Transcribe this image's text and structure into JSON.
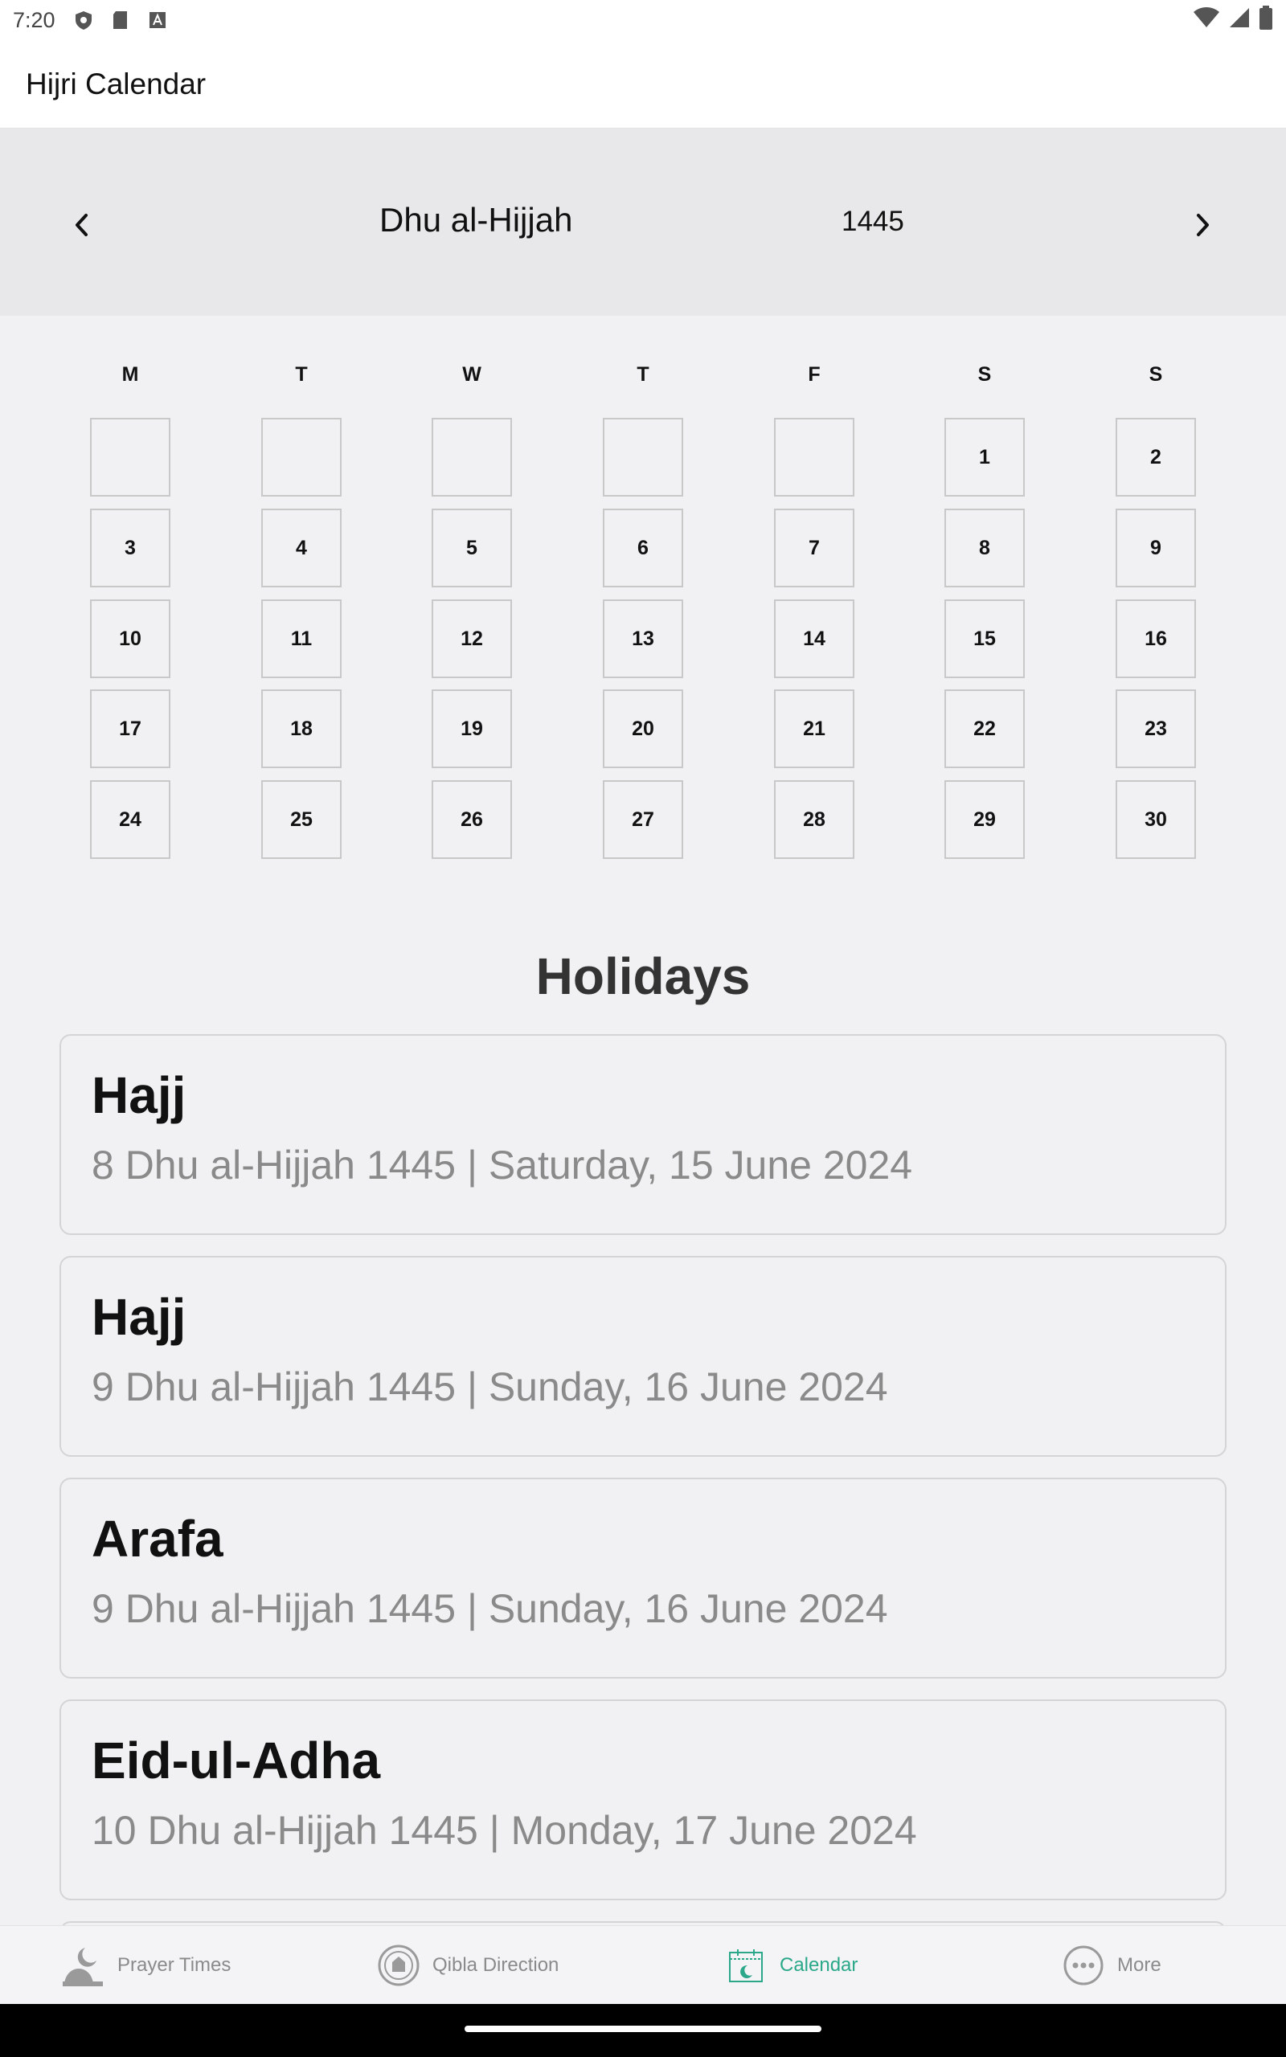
{
  "status_bar": {
    "time": "7:20"
  },
  "app_bar": {
    "title": "Hijri Calendar"
  },
  "month_nav": {
    "month": "Dhu al-Hijjah",
    "year": "1445"
  },
  "weekdays": [
    "M",
    "T",
    "W",
    "T",
    "F",
    "S",
    "S"
  ],
  "calendar": {
    "leading_blank_days": 5,
    "days": [
      "1",
      "2",
      "3",
      "4",
      "5",
      "6",
      "7",
      "8",
      "9",
      "10",
      "11",
      "12",
      "13",
      "14",
      "15",
      "16",
      "17",
      "18",
      "19",
      "20",
      "21",
      "22",
      "23",
      "24",
      "25",
      "26",
      "27",
      "28",
      "29",
      "30"
    ]
  },
  "holidays": {
    "title": "Holidays",
    "items": [
      {
        "name": "Hajj",
        "date": "8 Dhu al-Hijjah 1445 | Saturday, 15 June 2024"
      },
      {
        "name": "Hajj",
        "date": "9 Dhu al-Hijjah 1445 | Sunday, 16 June 2024"
      },
      {
        "name": "Arafa",
        "date": "9 Dhu al-Hijjah 1445 | Sunday, 16 June 2024"
      },
      {
        "name": "Eid-ul-Adha",
        "date": "10 Dhu al-Hijjah 1445 | Monday, 17 June 2024"
      }
    ]
  },
  "bottom_nav": {
    "items": [
      {
        "label": "Prayer Times",
        "icon": "mosque-moon-icon",
        "active": false
      },
      {
        "label": "Qibla Direction",
        "icon": "compass-icon",
        "active": false
      },
      {
        "label": "Calendar",
        "icon": "calendar-icon",
        "active": true
      },
      {
        "label": "More",
        "icon": "more-dots-icon",
        "active": false
      }
    ]
  },
  "colors": {
    "accent": "#2aa889",
    "header_bg": "#e8e8ea",
    "page_bg": "#f1f1f3"
  }
}
